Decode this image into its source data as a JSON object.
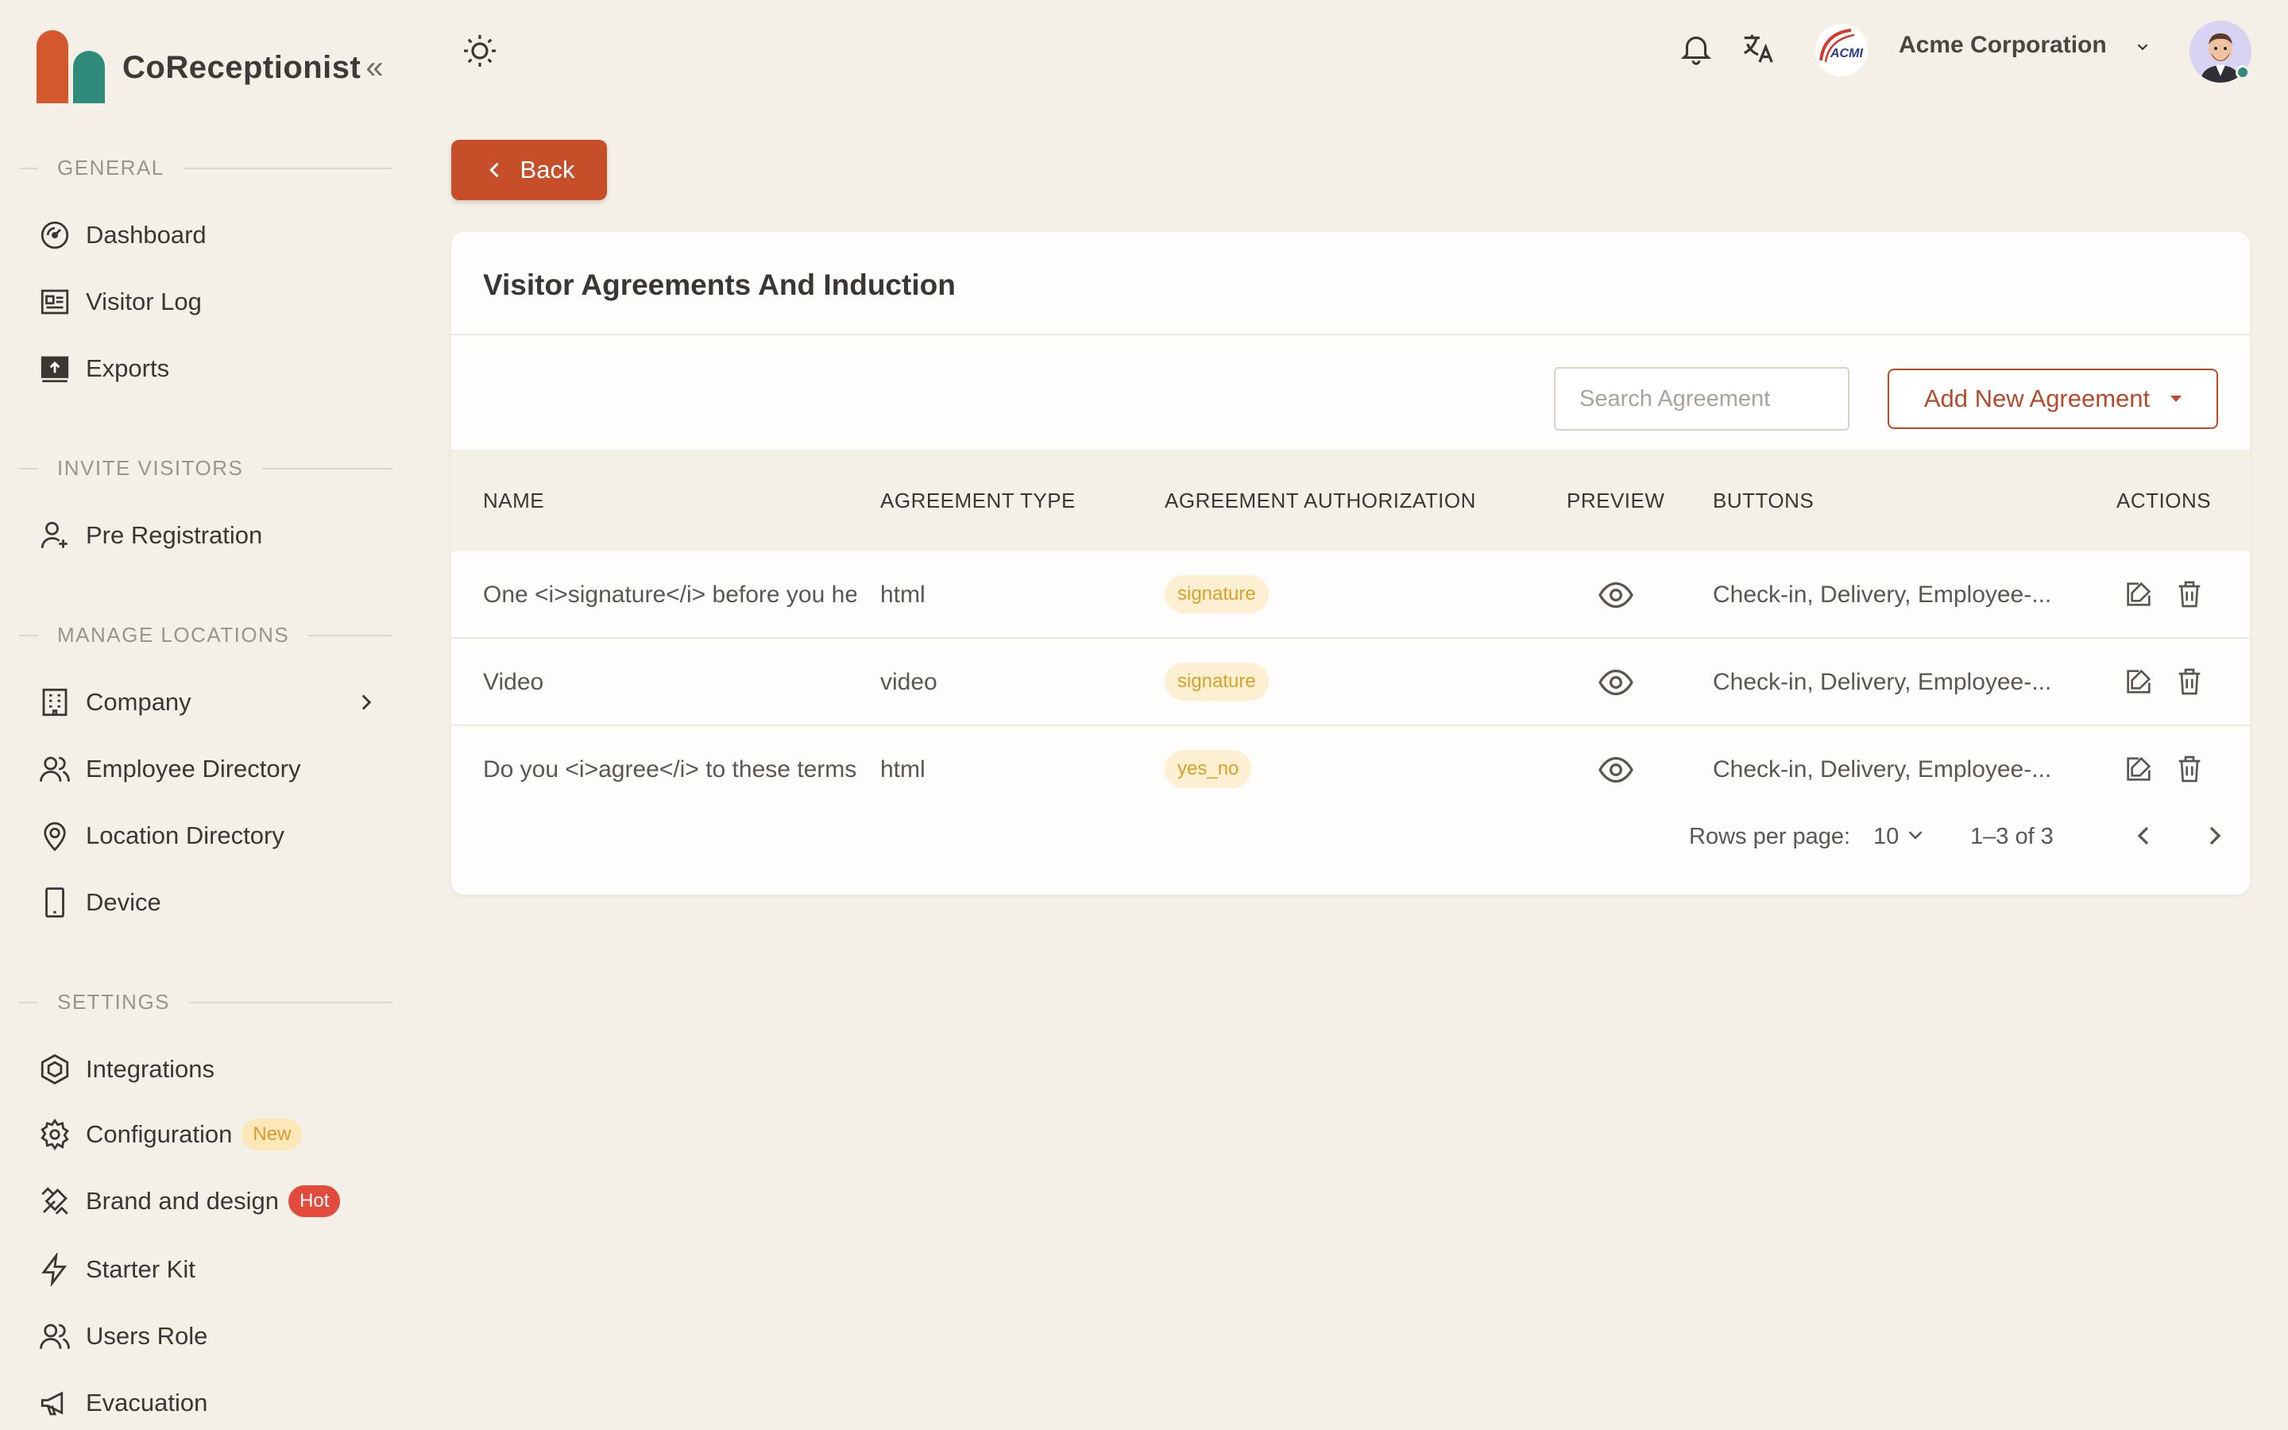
{
  "brand": {
    "name": "CoReceptionist",
    "collapse_glyph": "«"
  },
  "sidebar": {
    "sections": [
      {
        "label": "GENERAL"
      },
      {
        "label": "INVITE VISITORS"
      },
      {
        "label": "MANAGE LOCATIONS"
      },
      {
        "label": "SETTINGS"
      }
    ],
    "items": [
      {
        "label": "Dashboard",
        "icon": "dashboard-icon"
      },
      {
        "label": "Visitor Log",
        "icon": "visitor-log-icon"
      },
      {
        "label": "Exports",
        "icon": "exports-icon"
      },
      {
        "label": "Pre Registration",
        "icon": "user-plus-icon"
      },
      {
        "label": "Company",
        "icon": "building-icon"
      },
      {
        "label": "Employee Directory",
        "icon": "users-icon"
      },
      {
        "label": "Location Directory",
        "icon": "map-pin-icon"
      },
      {
        "label": "Device",
        "icon": "device-icon"
      },
      {
        "label": "Integrations",
        "icon": "integrations-icon"
      },
      {
        "label": "Configuration",
        "icon": "gear-icon",
        "badge": "New"
      },
      {
        "label": "Brand and design",
        "icon": "brush-icon",
        "badge": "Hot"
      },
      {
        "label": "Starter Kit",
        "icon": "bolt-icon"
      },
      {
        "label": "Users Role",
        "icon": "users-role-icon"
      },
      {
        "label": "Evacuation",
        "icon": "megaphone-icon"
      }
    ]
  },
  "header": {
    "org_name": "Acme Corporation",
    "org_logo_text": "ACMI"
  },
  "page": {
    "back_label": "Back",
    "title": "Visitor Agreements And Induction",
    "search_placeholder": "Search Agreement",
    "add_label": "Add New Agreement"
  },
  "table": {
    "columns": [
      "NAME",
      "AGREEMENT TYPE",
      "AGREEMENT AUTHORIZATION",
      "PREVIEW",
      "BUTTONS",
      "ACTIONS"
    ],
    "rows": [
      {
        "name": "One <i>signature</i> before you he",
        "type": "html",
        "authorization": "signature",
        "buttons": "Check-in, Delivery, Employee-..."
      },
      {
        "name": "Video",
        "type": "video",
        "authorization": "signature",
        "buttons": "Check-in, Delivery, Employee-..."
      },
      {
        "name": "Do you <i>agree</i> to these terms",
        "type": "html",
        "authorization": "yes_no",
        "buttons": "Check-in, Delivery, Employee-..."
      }
    ]
  },
  "pagination": {
    "rows_per_page_label": "Rows per page:",
    "rows_per_page": "10",
    "range": "1–3 of 3"
  },
  "colors": {
    "accent": "#c64f2a",
    "brand_orange": "#d4582d",
    "brand_teal": "#2f8a7a",
    "chip_bg": "#fdf0d2",
    "chip_text": "#d9a12a",
    "hot_badge": "#e24a3b"
  }
}
